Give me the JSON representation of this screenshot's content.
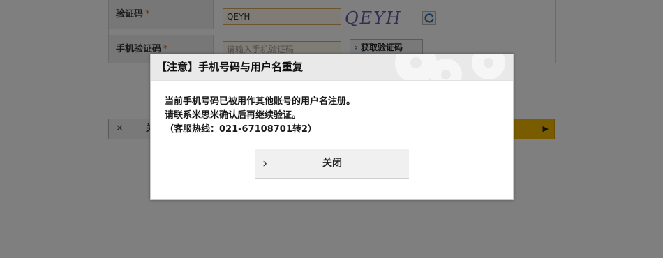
{
  "form": {
    "captcha": {
      "label": "验证码",
      "required_mark": "*",
      "value": "QEYH"
    },
    "captcha_image_text": "QEYH",
    "refresh_icon": "refresh-icon",
    "sms": {
      "label": "手机验证码",
      "required_mark": "*",
      "placeholder": "请输入手机验证码"
    },
    "get_code_button": "获取验证码",
    "bottom_left_button_partial": "关",
    "bottom_left_icon": "close-x-icon"
  },
  "modal": {
    "title": "【注意】手机号码与用户名重复",
    "lines": [
      "当前手机号码已被用作其他账号的用户名注册。",
      "请联系米思米确认后再继续验证。",
      "（客服热线：021-67108701转2）"
    ],
    "close_button": "关闭",
    "close_icon": "chevron-right-icon"
  },
  "colors": {
    "accent_yellow": "#f5b800",
    "required_orange": "#e05a1a",
    "overlay": "rgba(0,0,0,0.5)"
  }
}
